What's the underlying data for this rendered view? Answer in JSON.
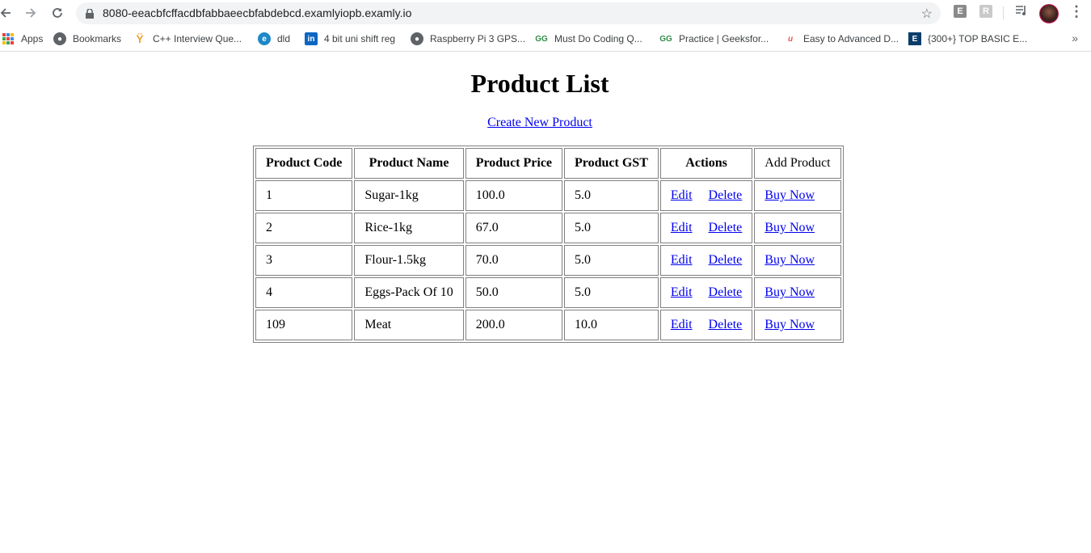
{
  "browser": {
    "url": "8080-eeacbfcffacdbfabbaeecbfabdebcd.examlyiopb.examly.io",
    "bookmarks": [
      {
        "label": "Apps",
        "icon": "apps-grid-icon"
      },
      {
        "label": "Bookmarks",
        "icon": "globe-icon"
      },
      {
        "label": "C++ Interview Que...",
        "icon": "interview-favicon"
      },
      {
        "label": "dld",
        "icon": "e-favicon"
      },
      {
        "label": "4 bit uni shift reg",
        "icon": "linkedin-icon"
      },
      {
        "label": "Raspberry Pi 3 GPS...",
        "icon": "globe-icon"
      },
      {
        "label": "Must Do Coding Q...",
        "icon": "geeksforgeeks-icon"
      },
      {
        "label": "Practice | Geeksfor...",
        "icon": "geeksforgeeks-icon"
      },
      {
        "label": "Easy to Advanced D...",
        "icon": "udemy-icon"
      },
      {
        "label": "{300+} TOP BASIC E...",
        "icon": "e-box-icon"
      }
    ],
    "more_label": "»"
  },
  "page": {
    "title": "Product List",
    "create_link": "Create New Product"
  },
  "table": {
    "headers": [
      "Product Code",
      "Product Name",
      "Product Price",
      "Product GST",
      "Actions",
      "Add Product"
    ],
    "rows": [
      {
        "code": "1",
        "name": "Sugar-1kg",
        "price": "100.0",
        "gst": "5.0"
      },
      {
        "code": "2",
        "name": "Rice-1kg",
        "price": "67.0",
        "gst": "5.0"
      },
      {
        "code": "3",
        "name": "Flour-1.5kg",
        "price": "70.0",
        "gst": "5.0"
      },
      {
        "code": "4",
        "name": "Eggs-Pack Of 10",
        "price": "50.0",
        "gst": "5.0"
      },
      {
        "code": "109",
        "name": "Meat",
        "price": "200.0",
        "gst": "10.0"
      }
    ],
    "edit_label": "Edit",
    "delete_label": "Delete",
    "buy_label": "Buy Now"
  },
  "colors": {
    "link": "#0000ee",
    "border": "#808080"
  }
}
